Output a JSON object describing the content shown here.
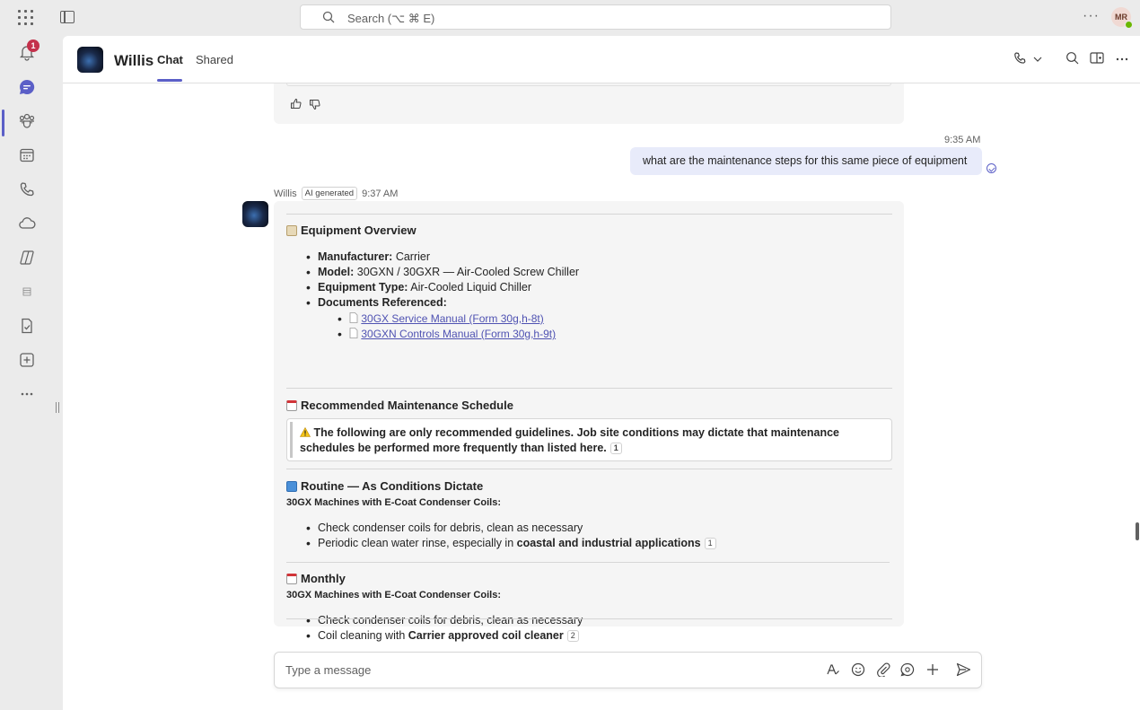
{
  "topbar": {
    "search_placeholder": "Search (⌥ ⌘ E)",
    "more": "···",
    "avatar_initials": "MR"
  },
  "rail": {
    "notification_count": "1"
  },
  "header": {
    "title": "Willis",
    "tabs": [
      {
        "label": "Chat",
        "active": true
      },
      {
        "label": "Shared",
        "active": false
      }
    ]
  },
  "conversation": {
    "user_message": {
      "time": "9:35 AM",
      "text": "what are the maintenance steps for this same piece of equipment"
    },
    "bot_message": {
      "sender": "Willis",
      "tag": "AI generated",
      "time": "9:37 AM",
      "overview": {
        "title": "Equipment Overview",
        "items": [
          {
            "label": "Manufacturer:",
            "value": "Carrier"
          },
          {
            "label": "Model:",
            "value": "30GXN / 30GXR — Air-Cooled Screw Chiller"
          },
          {
            "label": "Equipment Type:",
            "value": "Air-Cooled Liquid Chiller"
          },
          {
            "label": "Documents Referenced:",
            "value": ""
          }
        ],
        "documents": [
          "30GX Service Manual (Form 30g,h-8t)",
          "30GXN Controls Manual (Form 30g,h-9t)"
        ]
      },
      "schedule": {
        "title": "Recommended Maintenance Schedule",
        "callout": "The following are only recommended guidelines. Job site conditions may dictate that maintenance schedules be performed more frequently than listed here.",
        "callout_cite": "1"
      },
      "routine": {
        "title": "Routine — As Conditions Dictate",
        "subtitle": "30GX Machines with E-Coat Condenser Coils:",
        "item1": "Check condenser coils for debris, clean as necessary",
        "item2_prefix": "Periodic clean water rinse, especially in ",
        "item2_bold": "coastal and industrial applications",
        "item2_cite": "1"
      },
      "monthly": {
        "title": "Monthly",
        "subtitle": "30GX Machines with E-Coat Condenser Coils:",
        "item1": "Check condenser coils for debris, clean as necessary",
        "item2_prefix": "Coil cleaning with ",
        "item2_bold": "Carrier approved coil cleaner",
        "item2_cite": "2"
      }
    }
  },
  "compose": {
    "placeholder": "Type a message"
  },
  "colors": {
    "accent": "#5b5fc7",
    "user_bubble": "#e8ebfa",
    "card_bg": "#f5f5f5",
    "badge": "#c4314b"
  }
}
